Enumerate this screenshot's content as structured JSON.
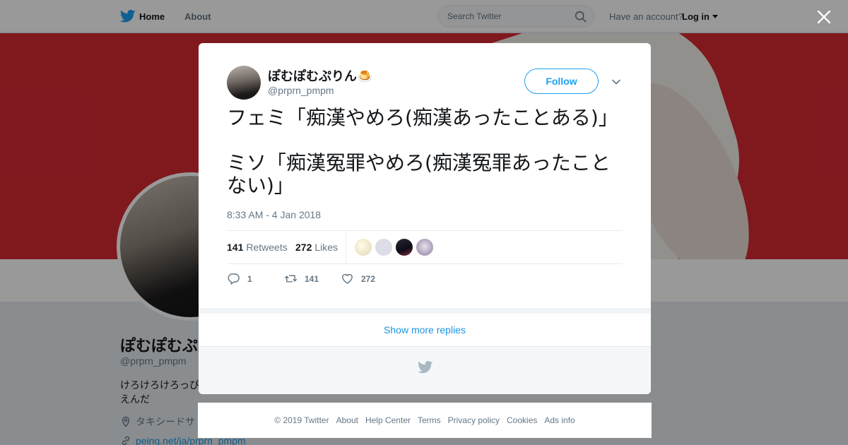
{
  "nav": {
    "home_label": "Home",
    "about_label": "About",
    "search_placeholder": "Search Twitter",
    "have_account": "Have an account?",
    "login_label": "Log in"
  },
  "profile": {
    "name": "ぽむぽむぷ",
    "handle": "@prprn_pmpm",
    "bio": "けろけろけろっぴ\nえんだ",
    "location": "タキシードサ",
    "link": "peing.net/ja/prprn_pmpm"
  },
  "tweet": {
    "name": "ぽむぽむぷりん🍮",
    "handle": "@prprn_pmpm",
    "follow_label": "Follow",
    "text": "フェミ「痴漢やめろ(痴漢あったことある)」\n\nミソ「痴漢冤罪やめろ(痴漢冤罪あったことない)」",
    "timestamp": "8:33 AM - 4 Jan 2018",
    "retweets_count": "141",
    "retweets_label": "Retweets",
    "likes_count": "272",
    "likes_label": "Likes",
    "reply_count": "1",
    "retweet_count": "141",
    "like_count": "272"
  },
  "show_more_label": "Show more replies",
  "footer": {
    "links": [
      "© 2019 Twitter",
      "About",
      "Help Center",
      "Terms",
      "Privacy policy",
      "Cookies",
      "Ads info"
    ]
  },
  "colors": {
    "accent": "#1da1f2",
    "link": "#1b95e0",
    "banner": "#d42a33",
    "muted": "#657786"
  }
}
